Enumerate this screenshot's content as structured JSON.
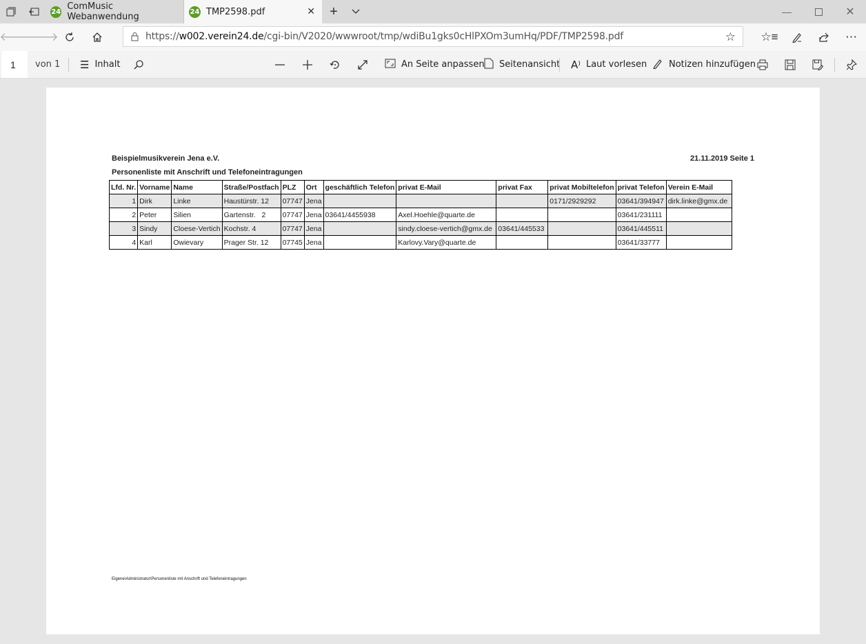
{
  "browser": {
    "tabs": [
      {
        "favicon": "24",
        "label": "ComMusic Webanwendung"
      },
      {
        "favicon": "24",
        "label": "TMP2598.pdf"
      }
    ],
    "url_prefix": "https://",
    "url_host": "w002.verein24.de",
    "url_path": "/cgi-bin/V2020/wwwroot/tmp/wdiBu1gks0cHlPXOm3umHq/PDF/TMP2598.pdf"
  },
  "pdf_toolbar": {
    "page_number": "1",
    "page_total": "von 1",
    "contents_label": "Inhalt",
    "fit_page_label": "An Seite anpassen",
    "page_view_label": "Seitenansicht",
    "read_aloud_label": "Laut vorlesen",
    "add_notes_label": "Notizen hinzufügen"
  },
  "document": {
    "organization": "Beispielmusikverein Jena e.V.",
    "date_page": "21.11.2019 Seite 1",
    "subtitle": "Personenliste mit Anschrift und Telefoneintragungen",
    "columns": [
      "Lfd. Nr.",
      "Vorname",
      "Name",
      "Straße/Postfach",
      "PLZ",
      "Ort",
      "geschäftlich Telefon",
      "privat E-Mail",
      "privat Fax",
      "privat Mobiltelefon",
      "privat Telefon",
      "Verein E-Mail"
    ],
    "rows": [
      [
        "1",
        "Dirk",
        "Linke",
        "Haustürstr. 12",
        "07747",
        "Jena",
        "",
        "",
        "",
        "0171/2929292",
        "03641/394947",
        "dirk.linke@gmx.de"
      ],
      [
        "2",
        "Peter",
        "Silien",
        "Gartenstr.   2",
        "07747",
        "Jena",
        "03641/4455938",
        "Axel.Hoehle@quarte.de",
        "",
        "",
        "03641/231111",
        ""
      ],
      [
        "3",
        "Sindy",
        "Cloese-Vertich",
        "Kochstr. 4",
        "07747",
        "Jena",
        "",
        "sindy.cloese-vertich@gmx.de",
        "03641/445533",
        "",
        "03641/445511",
        ""
      ],
      [
        "4",
        "Karl",
        "Owievary",
        "Prager Str. 12",
        "07745",
        "Jena",
        "",
        "Karlovy.Vary@quarte.de",
        "",
        "",
        "03641/33777",
        ""
      ]
    ],
    "footer": "Eigene\\Administrator\\Personenliste mit Anschrift und Telefoneintragungen"
  }
}
